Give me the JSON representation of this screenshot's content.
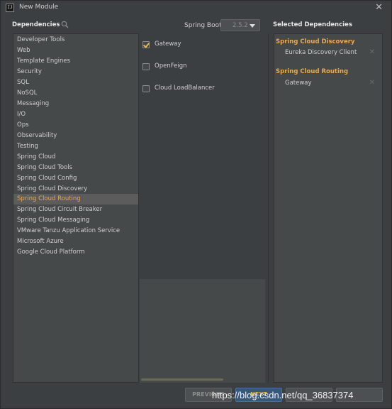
{
  "window": {
    "title": "New Module",
    "icon_text": "IJ"
  },
  "headers": {
    "dependencies": "Dependencies",
    "selected": "Selected Dependencies"
  },
  "spring_boot": {
    "label": "Spring Boot",
    "version": "2.5.2"
  },
  "categories": [
    "Developer Tools",
    "Web",
    "Template Engines",
    "Security",
    "SQL",
    "NoSQL",
    "Messaging",
    "I/O",
    "Ops",
    "Observability",
    "Testing",
    "Spring Cloud",
    "Spring Cloud Tools",
    "Spring Cloud Config",
    "Spring Cloud Discovery",
    "Spring Cloud Routing",
    "Spring Cloud Circuit Breaker",
    "Spring Cloud Messaging",
    "VMware Tanzu Application Service",
    "Microsoft Azure",
    "Google Cloud Platform"
  ],
  "selected_category": "Spring Cloud Routing",
  "dependencies": [
    {
      "label": "Gateway",
      "checked": true
    },
    {
      "label": "OpenFeign",
      "checked": false
    },
    {
      "label": "Cloud LoadBalancer",
      "checked": false
    }
  ],
  "selected_groups": [
    {
      "title": "Spring Cloud Discovery",
      "items": [
        "Eureka Discovery Client"
      ]
    },
    {
      "title": "Spring Cloud Routing",
      "items": [
        "Gateway"
      ]
    }
  ],
  "buttons": {
    "previous": "PREVIOUS",
    "next": "NEXT"
  },
  "watermark": "https://blog.csdn.net/qq_36837374",
  "colors": {
    "accent": "#e8a94f",
    "selection": "#5c5c5c",
    "panel": "#45494a",
    "background": "#3c3f41"
  }
}
